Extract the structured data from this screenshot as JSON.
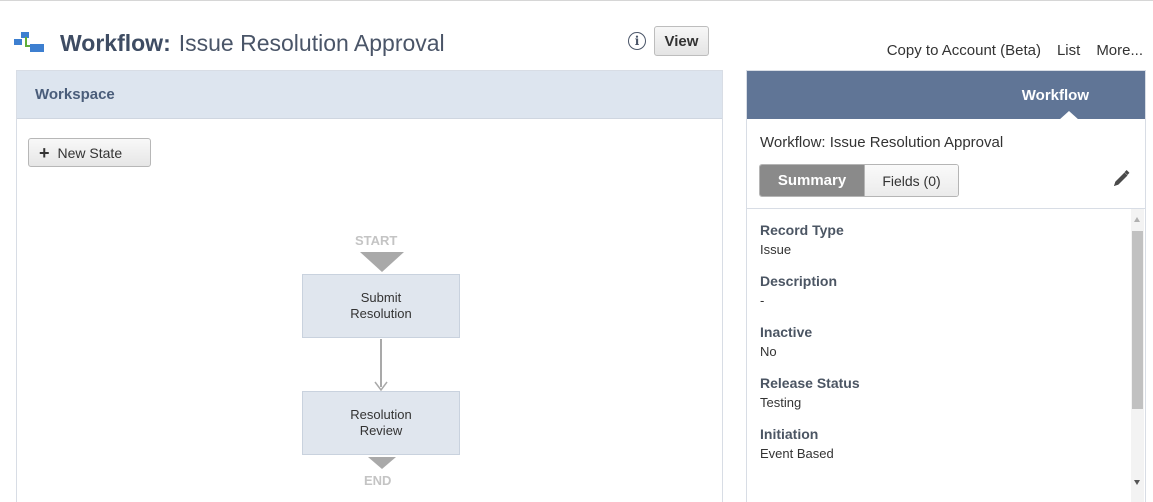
{
  "header": {
    "title_label": "Workflow:",
    "title_name": "Issue Resolution Approval",
    "info_icon": "info-icon",
    "view_button": "View",
    "links": [
      "Copy to Account (Beta)",
      "List",
      "More..."
    ]
  },
  "workspace": {
    "title": "Workspace",
    "new_state_button": "New State",
    "diagram": {
      "start_label": "START",
      "end_label": "END",
      "states": [
        {
          "line1": "Submit",
          "line2": "Resolution"
        },
        {
          "line1": "Resolution",
          "line2": "Review"
        }
      ]
    }
  },
  "right_panel": {
    "header": "Workflow",
    "workflow_title": "Workflow: Issue Resolution Approval",
    "tabs": {
      "summary": "Summary",
      "fields": "Fields (0)"
    },
    "fields": [
      {
        "label": "Record Type",
        "value": "Issue"
      },
      {
        "label": "Description",
        "value": "-"
      },
      {
        "label": "Inactive",
        "value": "No"
      },
      {
        "label": "Release Status",
        "value": "Testing"
      },
      {
        "label": "Initiation",
        "value": "Event Based"
      }
    ]
  },
  "colors": {
    "workspace_header_bg": "#dde5ef",
    "right_header_bg": "#607596",
    "state_box_bg": "#e0e6ee",
    "icon_blue": "#3d7fd0",
    "icon_green": "#5fae3a"
  }
}
